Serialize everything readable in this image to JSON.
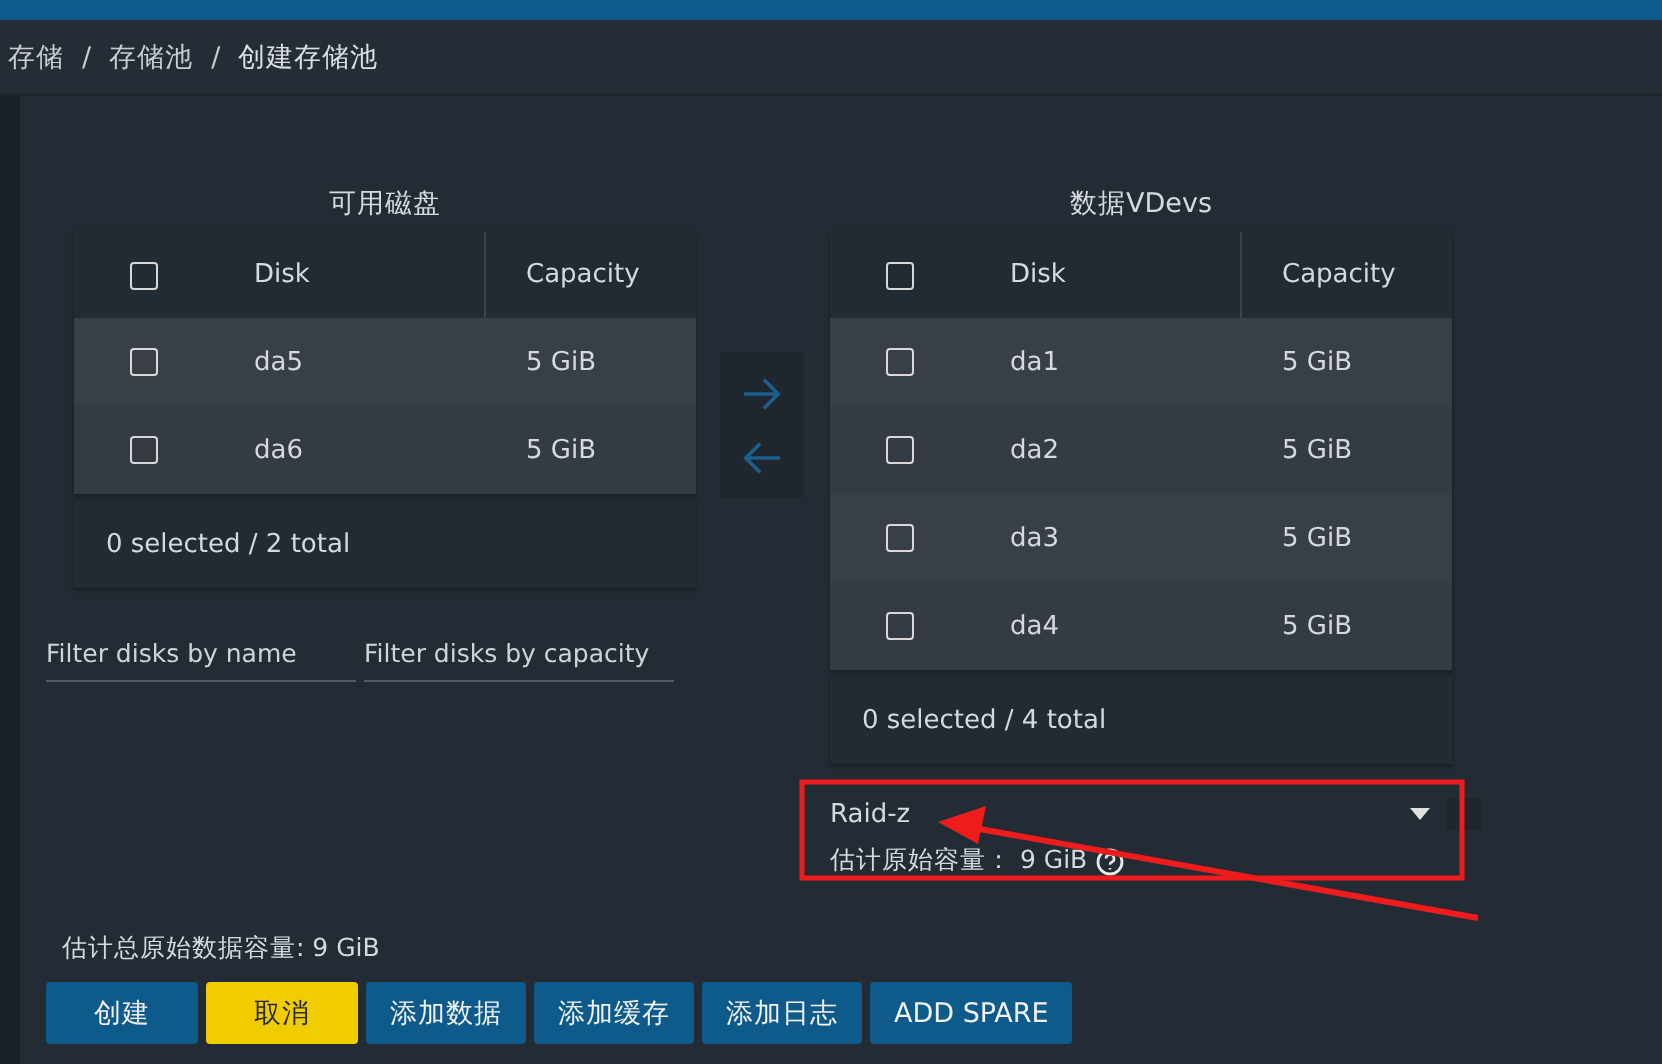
{
  "breadcrumb": [
    {
      "kind": "link",
      "text": "存储"
    },
    {
      "kind": "separator",
      "text": "/"
    },
    {
      "kind": "link",
      "text": "存储池"
    },
    {
      "kind": "separator",
      "text": "/"
    },
    {
      "kind": "current",
      "text": "创建存储池"
    }
  ],
  "available": {
    "title": "可用磁盘",
    "header_checked": false,
    "columns": [
      "Disk",
      "Capacity"
    ],
    "rows": [
      {
        "disk": "da5",
        "capacity": "5 GiB",
        "checked": false
      },
      {
        "disk": "da6",
        "capacity": "5 GiB",
        "checked": false
      }
    ],
    "footer": "0 selected / 2 total"
  },
  "filters": [
    {
      "placeholder": "Filter disks by name"
    },
    {
      "placeholder": "Filter disks by capacity"
    }
  ],
  "data_vdevs": {
    "title": "数据VDevs",
    "header_checked": false,
    "columns": [
      "Disk",
      "Capacity"
    ],
    "rows": [
      {
        "disk": "da1",
        "capacity": "5 GiB",
        "checked": false
      },
      {
        "disk": "da2",
        "capacity": "5 GiB",
        "checked": false
      },
      {
        "disk": "da3",
        "capacity": "5 GiB",
        "checked": false
      },
      {
        "disk": "da4",
        "capacity": "5 GiB",
        "checked": false
      }
    ],
    "footer": "0 selected / 4 total"
  },
  "layout_select": {
    "value": "Raid-z"
  },
  "raw_capacity": "估计原始容量： 9 GiB",
  "total_capacity": "估计总原始数据容量: 9 GiB",
  "buttons": [
    {
      "label": "创建",
      "kind": "primary"
    },
    {
      "label": "取消",
      "kind": "warning"
    },
    {
      "label": "添加数据",
      "kind": "primary"
    },
    {
      "label": "添加缓存",
      "kind": "primary"
    },
    {
      "label": "添加日志",
      "kind": "primary"
    },
    {
      "label": "ADD SPARE",
      "kind": "primary"
    }
  ]
}
